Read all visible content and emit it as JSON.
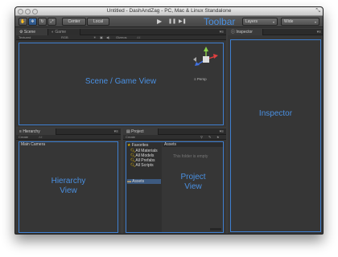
{
  "window": {
    "title": "Untitled - DashAndZag - PC, Mac & Linux Standalone",
    "resize_icon": "resize-icon"
  },
  "toolbar": {
    "label": "Toolbar",
    "center_label": "Center",
    "local_label": "Local",
    "layers_label": "Layers",
    "wide_label": "Wide",
    "play_glyph": "▶",
    "pause_glyph": "❚❚",
    "step_glyph": "▶❚",
    "hand_glyph": "✋",
    "move_glyph": "✥",
    "rotate_glyph": "↻",
    "scale_glyph": "⤢",
    "dropdown_glyph": "▾"
  },
  "scene_panel": {
    "tabs": [
      "Scene",
      "Game"
    ],
    "shading_mode": "Textured",
    "render_mode": "RGB",
    "gizmos_label": "Gizmos",
    "search_placeholder": "All",
    "persp_label": "Persp",
    "region_label": "Scene / Game View",
    "menu_glyph": "▾≡"
  },
  "hierarchy_panel": {
    "tab": "Hierarchy",
    "create_label": "Create",
    "search_placeholder": "All",
    "items": [
      "Main Camera"
    ],
    "region_label_line1": "Hierarchy",
    "region_label_line2": "View",
    "menu_glyph": "▾≡"
  },
  "project_panel": {
    "tab": "Project",
    "create_label": "Create",
    "favorites_label": "Favorites",
    "favorites": [
      "All Materials",
      "All Models",
      "All Prefabs",
      "All Scripts"
    ],
    "assets_label": "Assets",
    "assets_header": "Assets",
    "empty_text": "This folder is empty",
    "region_label_line1": "Project",
    "region_label_line2": "View",
    "menu_glyph": "▾≡"
  },
  "inspector_panel": {
    "tab": "Inspector",
    "region_label": "Inspector",
    "menu_glyph": "▾≡"
  },
  "colors": {
    "accent_blue": "#4a90e2",
    "outline_blue": "#3f7fd0",
    "panel_bg": "#363636"
  }
}
